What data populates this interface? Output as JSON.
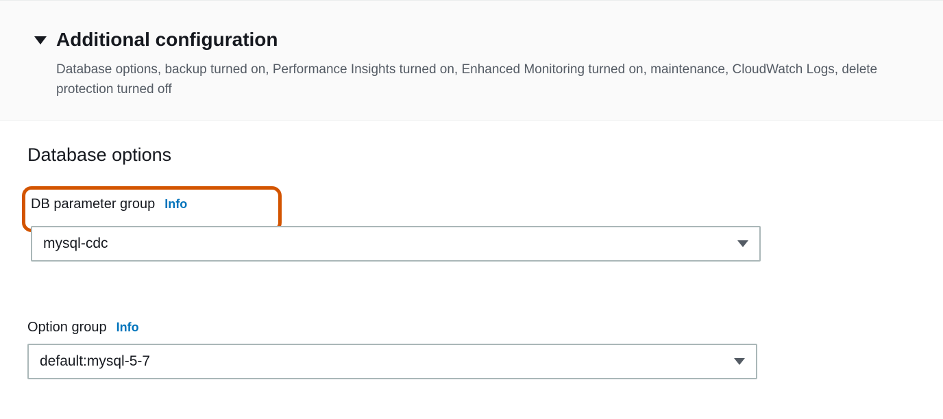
{
  "header": {
    "title": "Additional configuration",
    "description": "Database options, backup turned on, Performance Insights turned on, Enhanced Monitoring turned on, maintenance, CloudWatch Logs, delete protection turned off"
  },
  "section": {
    "title": "Database options"
  },
  "fields": {
    "db_parameter_group": {
      "label": "DB parameter group",
      "info_label": "Info",
      "value": "mysql-cdc"
    },
    "option_group": {
      "label": "Option group",
      "info_label": "Info",
      "value": "default:mysql-5-7"
    }
  }
}
